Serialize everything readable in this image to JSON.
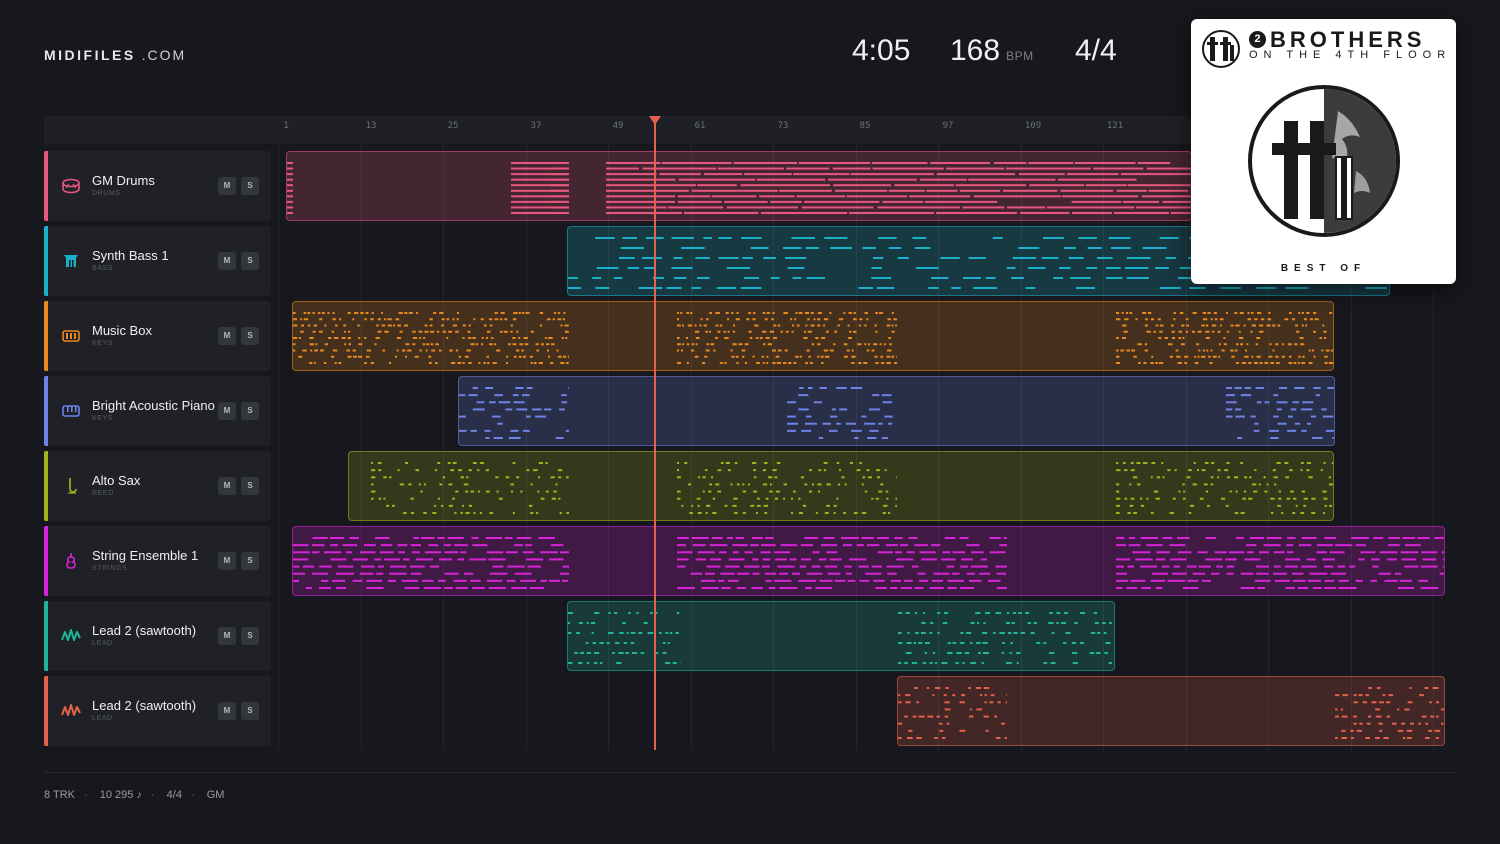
{
  "brand": {
    "bold": "MIDIFILES",
    "light": ".COM"
  },
  "header": {
    "duration": "4:05",
    "tempo": "168",
    "tempo_unit": "BPM",
    "time_signature": "4/4"
  },
  "ruler": {
    "ticks": [
      "1",
      "13",
      "25",
      "37",
      "49",
      "61",
      "73",
      "85",
      "97",
      "109",
      "121"
    ]
  },
  "tracks": [
    {
      "name": "GM Drums",
      "category": "DRUMS",
      "color": "#e8577f",
      "icon": "drum-icon",
      "mute": "M",
      "solo": "S"
    },
    {
      "name": "Synth Bass 1",
      "category": "BASS",
      "color": "#1ab0c9",
      "icon": "bass-icon",
      "mute": "M",
      "solo": "S"
    },
    {
      "name": "Music Box",
      "category": "KEYS",
      "color": "#e98a1e",
      "icon": "music-box-icon",
      "mute": "M",
      "solo": "S"
    },
    {
      "name": "Bright Acoustic Piano",
      "category": "KEYS",
      "color": "#6f82e6",
      "icon": "piano-icon",
      "mute": "M",
      "solo": "S"
    },
    {
      "name": "Alto Sax",
      "category": "REED",
      "color": "#a4b21c",
      "icon": "sax-icon",
      "mute": "M",
      "solo": "S"
    },
    {
      "name": "String Ensemble 1",
      "category": "STRINGS",
      "color": "#d823d8",
      "icon": "violin-icon",
      "mute": "M",
      "solo": "S"
    },
    {
      "name": "Lead 2 (sawtooth)",
      "category": "LEAD",
      "color": "#1fb59b",
      "icon": "sawtooth-wave-icon",
      "mute": "M",
      "solo": "S"
    },
    {
      "name": "Lead 2 (sawtooth)",
      "category": "LEAD",
      "color": "#e4614a",
      "icon": "sawtooth-wave-icon",
      "mute": "M",
      "solo": "S"
    }
  ],
  "footer": {
    "tracks": "8 TRK",
    "notes": "10 295 ♪",
    "time_signature": "4/4",
    "standard": "GM"
  },
  "album": {
    "number": "2",
    "title": "BROTHERS",
    "subtitle": "ON THE 4TH FLOOR",
    "caption": "BEST OF"
  }
}
